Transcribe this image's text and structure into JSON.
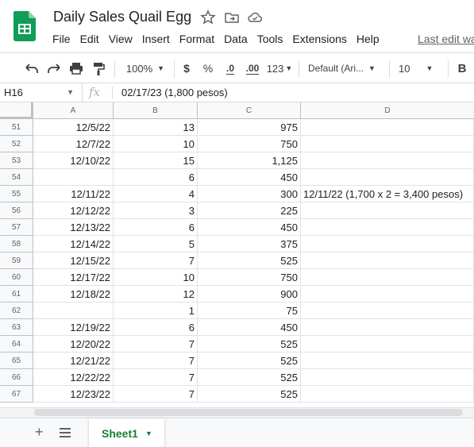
{
  "app": {
    "doc_title": "Daily Sales Quail Egg",
    "last_edit": "Last edit wa"
  },
  "menu": [
    "File",
    "Edit",
    "View",
    "Insert",
    "Format",
    "Data",
    "Tools",
    "Extensions",
    "Help"
  ],
  "toolbar": {
    "zoom": "100%",
    "currency": "$",
    "percent": "%",
    "decrease_decimal": ".0",
    "increase_decimal": ".00",
    "more_formats": "123",
    "font": "Default (Ari...",
    "font_size": "10",
    "bold": "B"
  },
  "formula_bar": {
    "cell_ref": "H16",
    "fx": "fx",
    "value": "02/17/23 (1,800 pesos)"
  },
  "columns": [
    "A",
    "B",
    "C",
    "D"
  ],
  "rows": [
    {
      "num": "51",
      "a": "12/5/22",
      "b": "13",
      "c": "975",
      "d": ""
    },
    {
      "num": "52",
      "a": "12/7/22",
      "b": "10",
      "c": "750",
      "d": ""
    },
    {
      "num": "53",
      "a": "12/10/22",
      "b": "15",
      "c": "1,125",
      "d": ""
    },
    {
      "num": "54",
      "a": "",
      "b": "6",
      "c": "450",
      "d": ""
    },
    {
      "num": "55",
      "a": "12/11/22",
      "b": "4",
      "c": "300",
      "d": "12/11/22 (1,700 x 2 = 3,400 pesos)"
    },
    {
      "num": "56",
      "a": "12/12/22",
      "b": "3",
      "c": "225",
      "d": ""
    },
    {
      "num": "57",
      "a": "12/13/22",
      "b": "6",
      "c": "450",
      "d": ""
    },
    {
      "num": "58",
      "a": "12/14/22",
      "b": "5",
      "c": "375",
      "d": ""
    },
    {
      "num": "59",
      "a": "12/15/22",
      "b": "7",
      "c": "525",
      "d": ""
    },
    {
      "num": "60",
      "a": "12/17/22",
      "b": "10",
      "c": "750",
      "d": ""
    },
    {
      "num": "61",
      "a": "12/18/22",
      "b": "12",
      "c": "900",
      "d": ""
    },
    {
      "num": "62",
      "a": "",
      "b": "1",
      "c": "75",
      "d": ""
    },
    {
      "num": "63",
      "a": "12/19/22",
      "b": "6",
      "c": "450",
      "d": ""
    },
    {
      "num": "64",
      "a": "12/20/22",
      "b": "7",
      "c": "525",
      "d": ""
    },
    {
      "num": "65",
      "a": "12/21/22",
      "b": "7",
      "c": "525",
      "d": ""
    },
    {
      "num": "66",
      "a": "12/22/22",
      "b": "7",
      "c": "525",
      "d": ""
    },
    {
      "num": "67",
      "a": "12/23/22",
      "b": "7",
      "c": "525",
      "d": ""
    }
  ],
  "sheets": {
    "active": "Sheet1"
  },
  "colors": {
    "brand_green": "#0f9d58",
    "sheet_tab_green": "#188038"
  }
}
